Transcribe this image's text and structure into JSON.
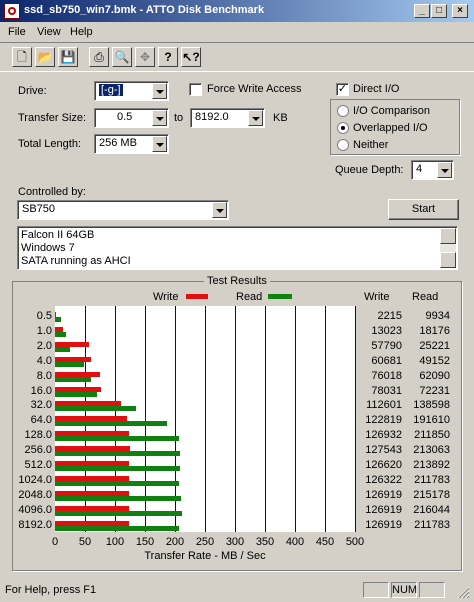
{
  "window": {
    "title": "ssd_sb750_win7.bmk - ATTO Disk Benchmark"
  },
  "menu": [
    "File",
    "View",
    "Help"
  ],
  "form": {
    "drive_label": "Drive:",
    "drive_value": "[-g-]",
    "force_write_label": "Force Write Access",
    "force_write_checked": false,
    "direct_io_label": "Direct I/O",
    "direct_io_checked": true,
    "transfer_size_label": "Transfer Size:",
    "transfer_from": "0.5",
    "to_label": "to",
    "transfer_to": "8192.0",
    "kb_label": "KB",
    "total_length_label": "Total Length:",
    "total_length_value": "256 MB",
    "io_options": [
      "I/O Comparison",
      "Overlapped I/O",
      "Neither"
    ],
    "io_selected": "Overlapped I/O",
    "queue_depth_label": "Queue Depth:",
    "queue_depth_value": "4",
    "controlled_by_label": "Controlled by:",
    "controlled_by_value": "SB750",
    "start_label": "Start",
    "notes": [
      "Falcon II 64GB",
      "Windows 7",
      "SATA running as AHCI"
    ]
  },
  "results": {
    "title": "Test Results",
    "write_legend": "Write",
    "read_legend": "Read",
    "write_header": "Write",
    "read_header": "Read",
    "xlabel": "Transfer Rate - MB / Sec"
  },
  "chart_data": {
    "type": "bar",
    "title": "Test Results",
    "xlabel": "Transfer Rate - MB / Sec",
    "xlim": [
      0,
      500
    ],
    "xticks": [
      "0",
      "50",
      "100",
      "150",
      "200",
      "250",
      "300",
      "350",
      "400",
      "450",
      "500"
    ],
    "categories": [
      "0.5",
      "1.0",
      "2.0",
      "4.0",
      "8.0",
      "16.0",
      "32.0",
      "64.0",
      "128.0",
      "256.0",
      "512.0",
      "1024.0",
      "2048.0",
      "4096.0",
      "8192.0"
    ],
    "series": [
      {
        "name": "Write",
        "color": "#e01010",
        "values": [
          2215,
          13023,
          57790,
          60681,
          76018,
          78031,
          112601,
          122819,
          126932,
          127543,
          126620,
          126322,
          126919,
          126919,
          126919
        ]
      },
      {
        "name": "Read",
        "color": "#108010",
        "values": [
          9934,
          18176,
          25221,
          49152,
          62090,
          72231,
          138598,
          191610,
          211850,
          213063,
          213892,
          211783,
          215178,
          216044,
          211783
        ]
      }
    ],
    "value_unit": "KB/s",
    "grid": true,
    "legend": "top"
  },
  "status": {
    "help_text": "For Help, press F1",
    "num": "NUM"
  },
  "colors": {
    "write": "#e01010",
    "read": "#108010",
    "grid": "#0000b0",
    "titlebar": "#0a246a"
  },
  "icons": [
    "new-icon",
    "open-icon",
    "save-icon",
    "print-icon",
    "print-preview-icon",
    "move-icon",
    "help-icon",
    "context-help-icon"
  ]
}
